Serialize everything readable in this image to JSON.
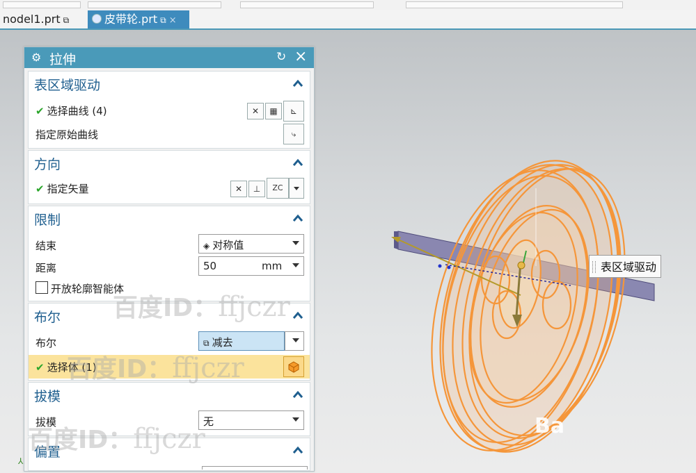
{
  "tabs": [
    {
      "label": "nodel1.prt",
      "pin": "⧉"
    },
    {
      "label": "皮带轮.prt",
      "pin": "⧉",
      "close": "×"
    }
  ],
  "dialog": {
    "title": "拉伸",
    "sections": {
      "region_drive": {
        "title": "表区域驱动",
        "select_curve": "选择曲线 (4)",
        "specify_curve": "指定原始曲线"
      },
      "direction": {
        "title": "方向",
        "specify_vector": "指定矢量",
        "vector_icon": "ZC"
      },
      "limits": {
        "title": "限制",
        "end_label": "结束",
        "end_value": "对称值",
        "distance_label": "距离",
        "distance_value": "50",
        "distance_unit": "mm",
        "open_profile": "开放轮廓智能体"
      },
      "boolean": {
        "title": "布尔",
        "bool_label": "布尔",
        "bool_value": "减去",
        "select_body": "选择体 (1)"
      },
      "draft": {
        "title": "拔模",
        "draft_label": "拔模",
        "draft_value": "无"
      },
      "offset": {
        "title": "偏置"
      }
    }
  },
  "tooltip": "表区域驱动",
  "watermarks": [
    "百度ID：",
    "ffjczr"
  ],
  "logo": "Ba",
  "colors": {
    "accent": "#4a9ab9",
    "section_title": "#1f5f8f",
    "highlight": "#fbe39c",
    "model": "#f5a04a",
    "rod": "#7b78a8"
  }
}
